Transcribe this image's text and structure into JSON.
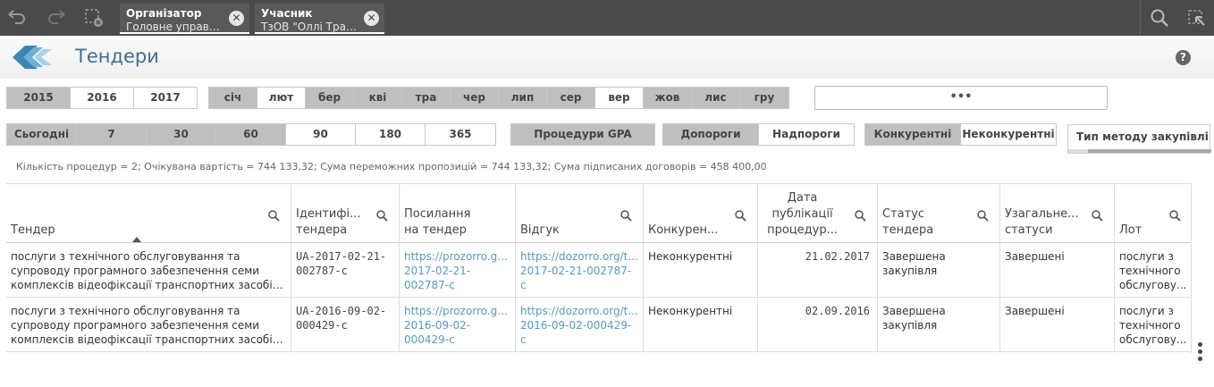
{
  "toolbar": {
    "selections": [
      {
        "field": "Організатор",
        "value": "Головне управлін..."
      },
      {
        "field": "Учасник",
        "value": "ТзОВ \"Оллі Транс\""
      }
    ],
    "clear_symbol": "✕"
  },
  "header": {
    "title": "Тендери",
    "help": "?"
  },
  "years": [
    {
      "label": "2015",
      "selected": false
    },
    {
      "label": "2016",
      "selected": true
    },
    {
      "label": "2017",
      "selected": true
    }
  ],
  "months": [
    {
      "label": "січ",
      "selected": false
    },
    {
      "label": "лют",
      "selected": true
    },
    {
      "label": "бер",
      "selected": false
    },
    {
      "label": "кві",
      "selected": false
    },
    {
      "label": "тра",
      "selected": false
    },
    {
      "label": "чер",
      "selected": false
    },
    {
      "label": "лип",
      "selected": false
    },
    {
      "label": "сер",
      "selected": false
    },
    {
      "label": "вер",
      "selected": true
    },
    {
      "label": "жов",
      "selected": false
    },
    {
      "label": "лис",
      "selected": false
    },
    {
      "label": "гру",
      "selected": false
    }
  ],
  "search": {
    "label": "•••"
  },
  "periods": [
    {
      "label": "Сьогодні",
      "selected": false
    },
    {
      "label": "7",
      "selected": false
    },
    {
      "label": "30",
      "selected": false
    },
    {
      "label": "60",
      "selected": false
    },
    {
      "label": "90",
      "selected": true
    },
    {
      "label": "180",
      "selected": true
    },
    {
      "label": "365",
      "selected": true
    }
  ],
  "gpa": {
    "label": "Процедури GPA"
  },
  "thresholds": [
    {
      "label": "Допороги",
      "selected": false
    },
    {
      "label": "Надпороги",
      "selected": true
    }
  ],
  "competition": [
    {
      "label": "Конкурентні",
      "selected": false
    },
    {
      "label": "Неконкурентні",
      "selected": true
    }
  ],
  "method": {
    "label": "Тип методу закупівлі"
  },
  "summary": "Кількість процедур = 2; Очікувана вартість = 744 133,32; Сума переможних пропозицій = 744 133,32; Сума підписаних договорів = 458 400,00",
  "table": {
    "columns": [
      {
        "l1": "",
        "l2": "",
        "l3": "Тендер"
      },
      {
        "l1": "",
        "l2": "Ідентифі...",
        "l3": "тендера"
      },
      {
        "l1": "",
        "l2": "Посилання",
        "l3": "на тендер"
      },
      {
        "l1": "",
        "l2": "",
        "l3": "Відгук"
      },
      {
        "l1": "",
        "l2": "",
        "l3": "Конкурен..."
      },
      {
        "l1": "Дата",
        "l2": "публікації",
        "l3": "процедур..."
      },
      {
        "l1": "",
        "l2": "Статус",
        "l3": "тендера"
      },
      {
        "l1": "",
        "l2": "Узагальне...",
        "l3": "статуси"
      },
      {
        "l1": "",
        "l2": "",
        "l3": "Лот"
      }
    ],
    "rows": [
      {
        "tender": [
          "послуги з технічного обслуговування та",
          "супроводу програмного забезпечення семи",
          "комплексів відеофіксації транспортних засобів з..."
        ],
        "id": [
          "UA-2017-02-21-",
          "002787-c"
        ],
        "link": [
          "https://prozorro.go...",
          "2017-02-21-",
          "002787-c"
        ],
        "review": [
          "https://dozorro.org/t...",
          "2017-02-21-002787-",
          "c"
        ],
        "competitive": "Неконкурентні",
        "date": "21.02.2017",
        "status": [
          "Завершена",
          "закупівля"
        ],
        "general": "Завершені",
        "lot": [
          "послуги з",
          "технічного",
          "обслугову..."
        ]
      },
      {
        "tender": [
          "послуги з технічного обслуговування та",
          "супроводу програмного забезпечення семи",
          "комплексів відеофіксації транспортних засобів з..."
        ],
        "id": [
          "UA-2016-09-02-",
          "000429-c"
        ],
        "link": [
          "https://prozorro.go...",
          "2016-09-02-",
          "000429-c"
        ],
        "review": [
          "https://dozorro.org/t...",
          "2016-09-02-000429-",
          "c"
        ],
        "competitive": "Неконкурентні",
        "date": "02.09.2016",
        "status": [
          "Завершена",
          "закупівля"
        ],
        "general": "Завершені",
        "lot": [
          "послуги з",
          "технічного",
          "обслугову..."
        ]
      }
    ]
  }
}
